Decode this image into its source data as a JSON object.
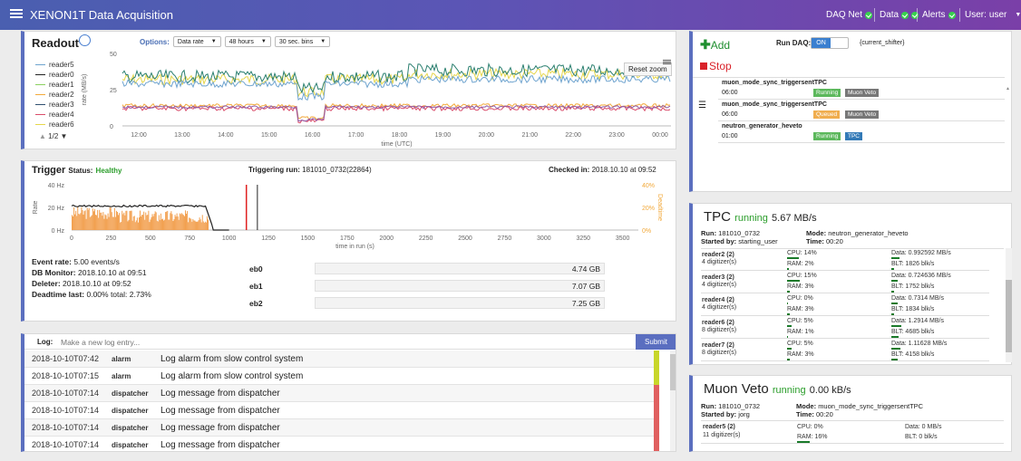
{
  "app": {
    "title": "XENON1T Data Acquisition"
  },
  "nav": {
    "daqnet": "DAQ Net",
    "data": "Data",
    "alerts": "Alerts",
    "user_label": "User:",
    "user": "user",
    "ok_color": "#36d24c"
  },
  "readout": {
    "title": "Readout",
    "options_label": "Options:",
    "sel1": "Data rate",
    "sel2": "48 hours",
    "sel3": "30 sec. bins",
    "reset": "Reset zoom",
    "page": "1/2",
    "legend": [
      {
        "name": "reader5",
        "color": "#6fa4cf"
      },
      {
        "name": "reader0",
        "color": "#222222"
      },
      {
        "name": "reader1",
        "color": "#8bd05f"
      },
      {
        "name": "reader2",
        "color": "#f2a93b"
      },
      {
        "name": "reader3",
        "color": "#2f4f6f"
      },
      {
        "name": "reader4",
        "color": "#d94c6a"
      },
      {
        "name": "reader6",
        "color": "#e6d64a"
      }
    ],
    "ylabel": "rate (MB/s)",
    "yticks": [
      "50",
      "25",
      "0"
    ],
    "xticks": [
      "12:00",
      "13:00",
      "14:00",
      "15:00",
      "16:00",
      "17:00",
      "18:00",
      "19:00",
      "20:00",
      "21:00",
      "22:00",
      "23:00",
      "00:00"
    ],
    "xlabel": "time (UTC)"
  },
  "trigger": {
    "title": "Trigger",
    "status_label": "Status:",
    "status": "Healthy",
    "run_label": "Triggering run:",
    "run": "181010_0732(22864)",
    "checked_label": "Checked in:",
    "checked": "2018.10.10 at 09:52",
    "yticks": [
      "40 Hz",
      "20 Hz",
      "0 Hz"
    ],
    "ylabel": "Rate",
    "ryticks": [
      "40%",
      "20%",
      "0%"
    ],
    "rlabel": "Deadtime",
    "xticks": [
      "0",
      "250",
      "500",
      "750",
      "1000",
      "1250",
      "1500",
      "1750",
      "2000",
      "2250",
      "2500",
      "2750",
      "3000",
      "3250",
      "3500"
    ],
    "xlabel": "time in run (s)",
    "event_rate_label": "Event rate:",
    "event_rate": "5.00 events/s",
    "dbmon_label": "DB Monitor:",
    "dbmon": "2018.10.10 at 09:51",
    "deleter_label": "Deleter:",
    "deleter": "2018.10.10 at 09:52",
    "dead_label": "Deadtime last:",
    "dead": "0.00% total: 2.73%",
    "eb": [
      {
        "name": "eb0",
        "val": "4.74 GB"
      },
      {
        "name": "eb1",
        "val": "7.07 GB"
      },
      {
        "name": "eb2",
        "val": "7.25 GB"
      }
    ]
  },
  "log": {
    "label": "Log:",
    "placeholder": "Make a new log entry...",
    "submit": "Submit",
    "rows": [
      {
        "date": "2018-10-10T07:42",
        "who": "alarm",
        "msg": "Log alarm from slow control system",
        "color": "#c8d62a"
      },
      {
        "date": "2018-10-10T07:15",
        "who": "alarm",
        "msg": "Log alarm from slow control system",
        "color": "#c8d62a"
      },
      {
        "date": "2018-10-10T07:14",
        "who": "dispatcher",
        "msg": "Log message from dispatcher",
        "color": "#e06060"
      },
      {
        "date": "2018-10-10T07:14",
        "who": "dispatcher",
        "msg": "Log message from dispatcher",
        "color": "#e06060"
      },
      {
        "date": "2018-10-10T07:14",
        "who": "dispatcher",
        "msg": "Log message from dispatcher",
        "color": "#e06060"
      },
      {
        "date": "2018-10-10T07:14",
        "who": "dispatcher",
        "msg": "Log message from dispatcher",
        "color": "#e06060"
      }
    ]
  },
  "queue": {
    "add": "Add",
    "run_daq": "Run DAQ:",
    "on": "ON",
    "shifter": "{current_shifter}",
    "stop": "Stop",
    "items": [
      {
        "name": "muon_mode_sync_triggersentTPC",
        "time": "06:00",
        "status": "Running",
        "status_color": "#5cb85c",
        "det": "Muon Veto",
        "det_color": "#777777"
      },
      {
        "name": "muon_mode_sync_triggersentTPC",
        "time": "06:00",
        "status": "Queued",
        "status_color": "#f0ad4e",
        "det": "Muon Veto",
        "det_color": "#777777"
      },
      {
        "name": "neutron_generator_heveto",
        "time": "01:00",
        "status": "Running",
        "status_color": "#5cb85c",
        "det": "TPC",
        "det_color": "#337ab7"
      }
    ]
  },
  "tpc": {
    "name": "TPC",
    "state": "running",
    "rate": "5.67 MB/s",
    "run_label": "Run:",
    "run": "181010_0732",
    "started_label": "Started by:",
    "started": "starting_user",
    "mode_label": "Mode:",
    "mode": "neutron_generator_heveto",
    "time_label": "Time:",
    "time": "00:20",
    "readers": [
      {
        "name": "reader2 (2)",
        "dig": "4 digitizer(s)",
        "cpu": "CPU: 14%",
        "ram": "RAM: 2%",
        "data": "Data: 0.992592 MB/s",
        "blt": "BLT: 1826 blk/s",
        "cpu_frac": 0.14,
        "ram_frac": 0.02,
        "data_frac": 0.3,
        "blt_frac": 0.08
      },
      {
        "name": "reader3 (2)",
        "dig": "4 digitizer(s)",
        "cpu": "CPU: 15%",
        "ram": "RAM: 3%",
        "data": "Data: 0.724636 MB/s",
        "blt": "BLT: 1752 blk/s",
        "cpu_frac": 0.15,
        "ram_frac": 0.03,
        "data_frac": 0.22,
        "blt_frac": 0.08
      },
      {
        "name": "reader4 (2)",
        "dig": "4 digitizer(s)",
        "cpu": "CPU: 0%",
        "ram": "RAM: 3%",
        "data": "Data: 0.7314 MB/s",
        "blt": "BLT: 1834 blk/s",
        "cpu_frac": 0,
        "ram_frac": 0.03,
        "data_frac": 0.22,
        "blt_frac": 0.08
      },
      {
        "name": "reader6 (2)",
        "dig": "8 digitizer(s)",
        "cpu": "CPU: 5%",
        "ram": "RAM: 1%",
        "data": "Data: 1.2914 MB/s",
        "blt": "BLT: 4685 blk/s",
        "cpu_frac": 0.05,
        "ram_frac": 0.01,
        "data_frac": 0.38,
        "blt_frac": 0.2
      },
      {
        "name": "reader7 (2)",
        "dig": "8 digitizer(s)",
        "cpu": "CPU: 5%",
        "ram": "RAM: 3%",
        "data": "Data: 1.11628 MB/s",
        "blt": "BLT: 4158 blk/s",
        "cpu_frac": 0.05,
        "ram_frac": 0.03,
        "data_frac": 0.33,
        "blt_frac": 0.18
      }
    ]
  },
  "mv": {
    "name": "Muon Veto",
    "state": "running",
    "rate": "0.00 kB/s",
    "run_label": "Run:",
    "run": "181010_0732",
    "started_label": "Started by:",
    "started": "jorg",
    "mode_label": "Mode:",
    "mode": "muon_mode_sync_triggersentTPC",
    "time_label": "Time:",
    "time": "00:20",
    "reader": {
      "name": "reader5 (2)",
      "dig": "11 digitizer(s)",
      "cpu": "CPU: 0%",
      "ram": "RAM: 16%",
      "data": "Data: 0 MB/s",
      "blt": "BLT: 0 blk/s",
      "ram_frac": 0.16
    }
  }
}
